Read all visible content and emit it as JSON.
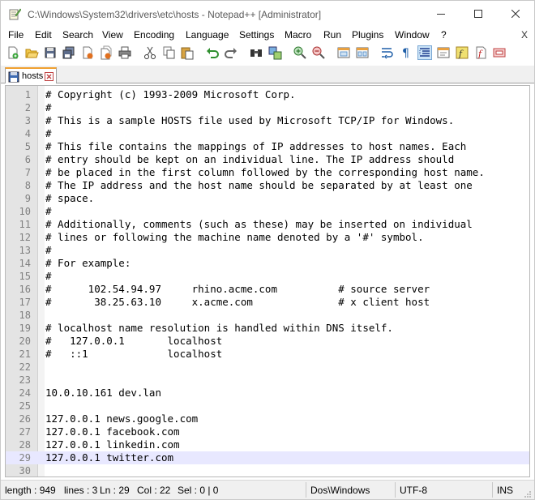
{
  "window": {
    "title": "C:\\Windows\\System32\\drivers\\etc\\hosts - Notepad++ [Administrator]"
  },
  "menu": {
    "items": [
      "File",
      "Edit",
      "Search",
      "View",
      "Encoding",
      "Language",
      "Settings",
      "Macro",
      "Run",
      "Plugins",
      "Window",
      "?"
    ],
    "close_label": "X"
  },
  "toolbar": {
    "buttons": [
      "new-file",
      "open-file",
      "save",
      "save-all",
      "close",
      "close-all",
      "print",
      "cut",
      "copy",
      "paste",
      "undo",
      "redo",
      "find",
      "replace",
      "zoom-in",
      "zoom-out",
      "sync-vertical",
      "sync-horizontal",
      "word-wrap",
      "show-all-chars",
      "indent-guide",
      "document-map",
      "function-list",
      "record-macro",
      "stop-recording"
    ]
  },
  "tab": {
    "label": "hosts"
  },
  "editor": {
    "current_line": 29,
    "lines": [
      "# Copyright (c) 1993-2009 Microsoft Corp.",
      "#",
      "# This is a sample HOSTS file used by Microsoft TCP/IP for Windows.",
      "#",
      "# This file contains the mappings of IP addresses to host names. Each",
      "# entry should be kept on an individual line. The IP address should",
      "# be placed in the first column followed by the corresponding host name.",
      "# The IP address and the host name should be separated by at least one",
      "# space.",
      "#",
      "# Additionally, comments (such as these) may be inserted on individual",
      "# lines or following the machine name denoted by a '#' symbol.",
      "#",
      "# For example:",
      "#",
      "#      102.54.94.97     rhino.acme.com          # source server",
      "#       38.25.63.10     x.acme.com              # x client host",
      "",
      "# localhost name resolution is handled within DNS itself.",
      "#   127.0.0.1       localhost",
      "#   ::1             localhost",
      "",
      "",
      "10.0.10.161 dev.lan",
      "",
      "127.0.0.1 news.google.com",
      "127.0.0.1 facebook.com",
      "127.0.0.1 linkedin.com",
      "127.0.0.1 twitter.com",
      ""
    ]
  },
  "status": {
    "length": "length : 949",
    "lines": "lines : 3",
    "ln": "Ln : 29",
    "col": "Col : 22",
    "sel": "Sel : 0 | 0",
    "eol": "Dos\\Windows",
    "encoding": "UTF-8",
    "mode": "INS"
  }
}
